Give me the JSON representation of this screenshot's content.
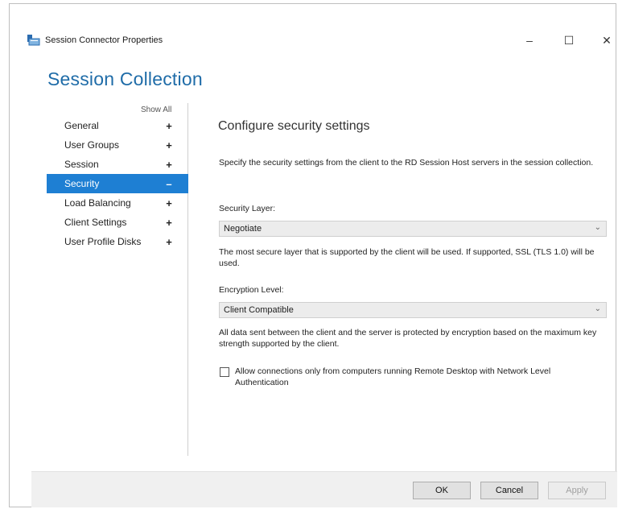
{
  "window": {
    "title": "Session Connector Properties",
    "minimize": "–",
    "maximize": "☐",
    "close": "✕"
  },
  "heading": "Session Collection",
  "nav": {
    "show_all": "Show All",
    "items": [
      {
        "label": "General",
        "sign": "+"
      },
      {
        "label": "User Groups",
        "sign": "+"
      },
      {
        "label": "Session",
        "sign": "+"
      },
      {
        "label": "Security",
        "sign": "–"
      },
      {
        "label": "Load Balancing",
        "sign": "+"
      },
      {
        "label": "Client Settings",
        "sign": "+"
      },
      {
        "label": "User Profile Disks",
        "sign": "+"
      }
    ]
  },
  "content": {
    "title": "Configure security settings",
    "intro": "Specify the security settings from the client to the RD Session Host servers in the session collection.",
    "security_layer": {
      "label": "Security Layer:",
      "value": "Negotiate",
      "description": "The most secure layer that is supported by the client will be used. If supported, SSL (TLS 1.0) will be used."
    },
    "encryption_level": {
      "label": "Encryption Level:",
      "value": "Client Compatible",
      "description": "All data sent between the client and the server is protected by encryption based on the maximum key strength supported by the client."
    },
    "nla_checkbox": {
      "label": "Allow connections only from computers running Remote Desktop with Network Level Authentication",
      "checked": false
    }
  },
  "footer": {
    "ok": "OK",
    "cancel": "Cancel",
    "apply": "Apply"
  },
  "colors": {
    "accent": "#1e7fd3",
    "heading": "#1f6ca8"
  }
}
